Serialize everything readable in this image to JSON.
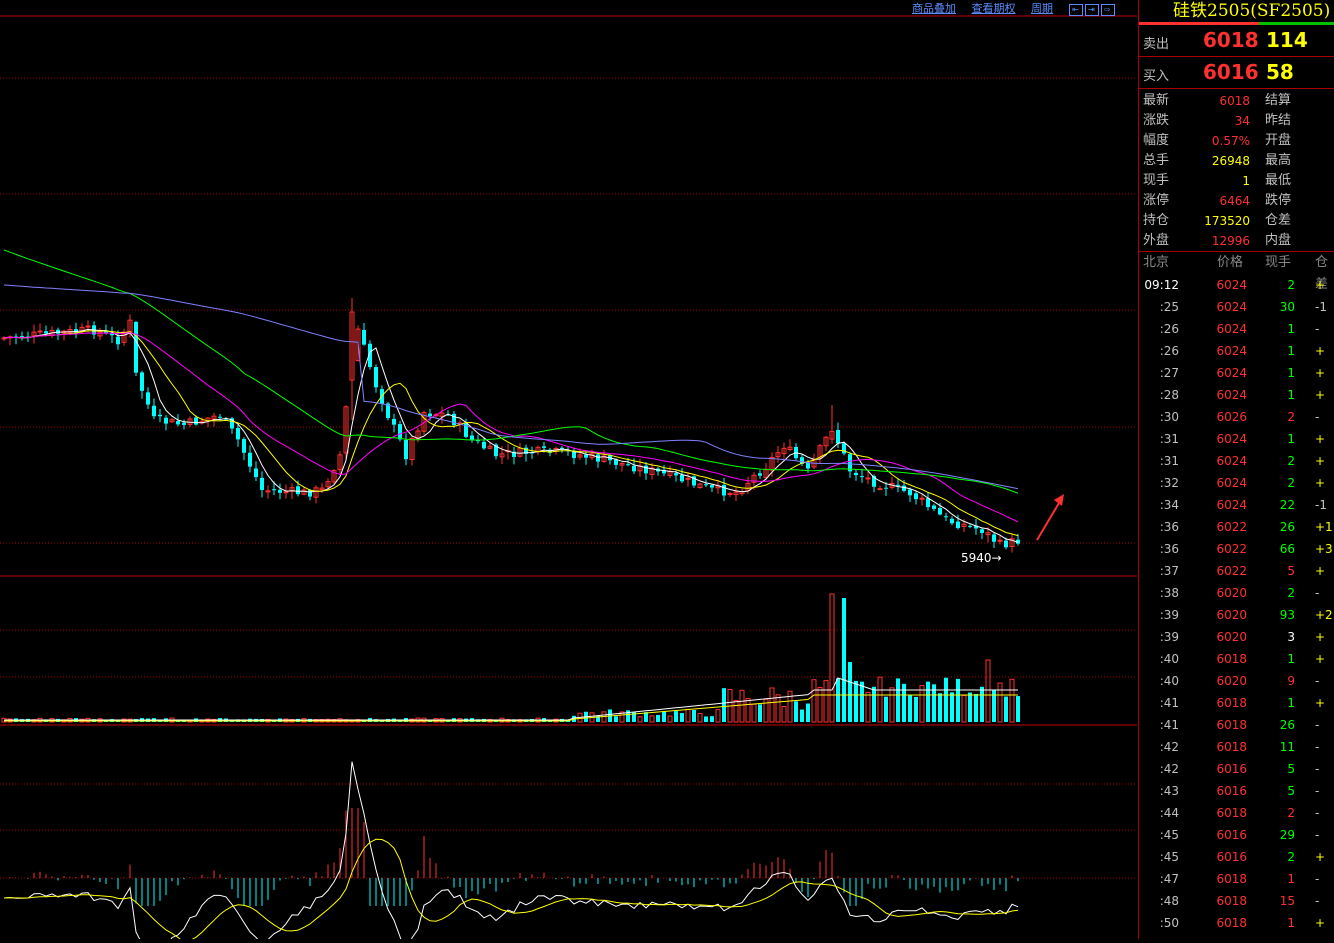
{
  "toolbar": {
    "links": [
      "商品叠加",
      "查看期权",
      "周期"
    ],
    "nav_icons": [
      "left-first-icon",
      "right-arrow-icon",
      "right-last-icon"
    ]
  },
  "chart": {
    "low_marker": "5940",
    "colors": {
      "up": "#ff3030",
      "down": "#00ffff",
      "ma5": "#ffffff",
      "ma10": "#ffff00",
      "ma20": "#ff00ff",
      "ma40": "#00ff00",
      "ma60": "#8080ff",
      "grid": "#a00000"
    }
  },
  "quote": {
    "title": "硅铁2505(SF2505)",
    "sell": {
      "label": "卖出",
      "price": "6018",
      "volume": "114"
    },
    "buy": {
      "label": "买入",
      "price": "6016",
      "volume": "58"
    },
    "stats": [
      {
        "label": "最新",
        "value": "6018",
        "color": "#ff3030",
        "label2": "结算"
      },
      {
        "label": "涨跌",
        "value": "34",
        "color": "#ff3030",
        "label2": "昨结"
      },
      {
        "label": "幅度",
        "value": "0.57%",
        "color": "#ff3030",
        "label2": "开盘"
      },
      {
        "label": "总手",
        "value": "26948",
        "color": "#ffff00",
        "label2": "最高"
      },
      {
        "label": "现手",
        "value": "1",
        "color": "#ffff00",
        "label2": "最低"
      },
      {
        "label": "涨停",
        "value": "6464",
        "color": "#ff3030",
        "label2": "跌停"
      },
      {
        "label": "持仓",
        "value": "173520",
        "color": "#ffff00",
        "label2": "仓差"
      },
      {
        "label": "外盘",
        "value": "12996",
        "color": "#ff3030",
        "label2": "内盘"
      }
    ]
  },
  "ticks": {
    "headers": [
      "北京",
      "价格",
      "现手",
      "仓差"
    ],
    "rows": [
      {
        "time": "09:12",
        "price": "6024",
        "qty": "2",
        "qcolor": "#00ff00",
        "chg": "+",
        "ccolor": "#ffff00"
      },
      {
        "time": ":25",
        "price": "6024",
        "qty": "30",
        "qcolor": "#00ff00",
        "chg": "-1",
        "ccolor": "#c0c0c0"
      },
      {
        "time": ":26",
        "price": "6024",
        "qty": "1",
        "qcolor": "#00ff00",
        "chg": "-",
        "ccolor": "#c0c0c0"
      },
      {
        "time": ":26",
        "price": "6024",
        "qty": "1",
        "qcolor": "#00ff00",
        "chg": "+",
        "ccolor": "#ffff00"
      },
      {
        "time": ":27",
        "price": "6024",
        "qty": "1",
        "qcolor": "#00ff00",
        "chg": "+",
        "ccolor": "#ffff00"
      },
      {
        "time": ":28",
        "price": "6024",
        "qty": "1",
        "qcolor": "#00ff00",
        "chg": "+",
        "ccolor": "#ffff00"
      },
      {
        "time": ":30",
        "price": "6026",
        "qty": "2",
        "qcolor": "#ff3030",
        "chg": "-",
        "ccolor": "#c0c0c0"
      },
      {
        "time": ":31",
        "price": "6024",
        "qty": "1",
        "qcolor": "#00ff00",
        "chg": "+",
        "ccolor": "#ffff00"
      },
      {
        "time": ":31",
        "price": "6024",
        "qty": "2",
        "qcolor": "#00ff00",
        "chg": "+",
        "ccolor": "#ffff00"
      },
      {
        "time": ":32",
        "price": "6024",
        "qty": "2",
        "qcolor": "#00ff00",
        "chg": "+",
        "ccolor": "#ffff00"
      },
      {
        "time": ":34",
        "price": "6024",
        "qty": "22",
        "qcolor": "#00ff00",
        "chg": "-1",
        "ccolor": "#c0c0c0"
      },
      {
        "time": ":36",
        "price": "6022",
        "qty": "26",
        "qcolor": "#00ff00",
        "chg": "+1",
        "ccolor": "#ffff00"
      },
      {
        "time": ":36",
        "price": "6022",
        "qty": "66",
        "qcolor": "#00ff00",
        "chg": "+3",
        "ccolor": "#ffff00"
      },
      {
        "time": ":37",
        "price": "6022",
        "qty": "5",
        "qcolor": "#ff3030",
        "chg": "+",
        "ccolor": "#ffff00"
      },
      {
        "time": ":38",
        "price": "6020",
        "qty": "2",
        "qcolor": "#00ff00",
        "chg": "-",
        "ccolor": "#c0c0c0"
      },
      {
        "time": ":39",
        "price": "6020",
        "qty": "93",
        "qcolor": "#00ff00",
        "chg": "+2",
        "ccolor": "#ffff00"
      },
      {
        "time": ":39",
        "price": "6020",
        "qty": "3",
        "qcolor": "#ffffff",
        "chg": "+",
        "ccolor": "#ffff00"
      },
      {
        "time": ":40",
        "price": "6018",
        "qty": "1",
        "qcolor": "#00ff00",
        "chg": "+",
        "ccolor": "#ffff00"
      },
      {
        "time": ":40",
        "price": "6020",
        "qty": "9",
        "qcolor": "#ff3030",
        "chg": "-",
        "ccolor": "#c0c0c0"
      },
      {
        "time": ":41",
        "price": "6018",
        "qty": "1",
        "qcolor": "#00ff00",
        "chg": "+",
        "ccolor": "#ffff00"
      },
      {
        "time": ":41",
        "price": "6018",
        "qty": "26",
        "qcolor": "#00ff00",
        "chg": "-",
        "ccolor": "#c0c0c0"
      },
      {
        "time": ":42",
        "price": "6018",
        "qty": "11",
        "qcolor": "#00ff00",
        "chg": "-",
        "ccolor": "#c0c0c0"
      },
      {
        "time": ":42",
        "price": "6016",
        "qty": "5",
        "qcolor": "#00ff00",
        "chg": "-",
        "ccolor": "#c0c0c0"
      },
      {
        "time": ":43",
        "price": "6016",
        "qty": "5",
        "qcolor": "#00ff00",
        "chg": "-",
        "ccolor": "#c0c0c0"
      },
      {
        "time": ":44",
        "price": "6018",
        "qty": "2",
        "qcolor": "#ff3030",
        "chg": "-",
        "ccolor": "#c0c0c0"
      },
      {
        "time": ":45",
        "price": "6016",
        "qty": "29",
        "qcolor": "#00ff00",
        "chg": "-",
        "ccolor": "#c0c0c0"
      },
      {
        "time": ":45",
        "price": "6016",
        "qty": "2",
        "qcolor": "#00ff00",
        "chg": "+",
        "ccolor": "#ffff00"
      },
      {
        "time": ":47",
        "price": "6018",
        "qty": "1",
        "qcolor": "#ff3030",
        "chg": "-",
        "ccolor": "#c0c0c0"
      },
      {
        "time": ":48",
        "price": "6018",
        "qty": "15",
        "qcolor": "#ff3030",
        "chg": "-",
        "ccolor": "#c0c0c0"
      },
      {
        "time": ":50",
        "price": "6018",
        "qty": "1",
        "qcolor": "#ff3030",
        "chg": "+",
        "ccolor": "#ffff00"
      }
    ]
  }
}
